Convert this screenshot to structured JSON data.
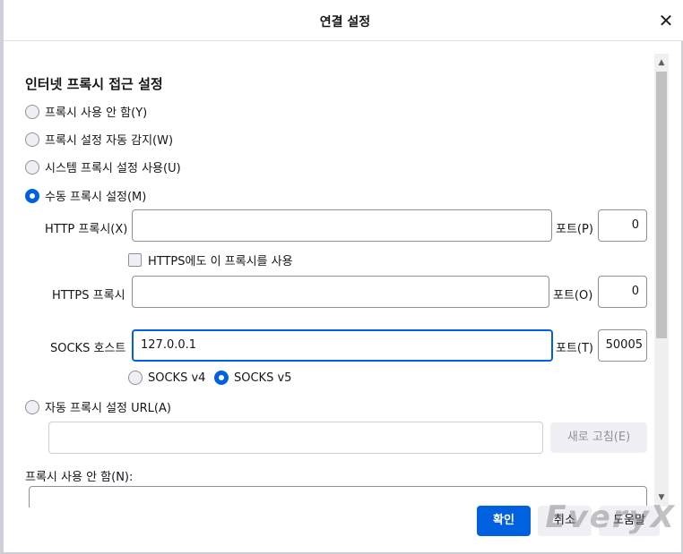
{
  "dialog": {
    "title": "연결 설정",
    "close_icon": "close-icon"
  },
  "proxy": {
    "section_title": "인터넷 프록시 접근 설정",
    "options": [
      {
        "label": "프록시 사용 안 함(Y)",
        "selected": false
      },
      {
        "label": "프록시 설정 자동 감지(W)",
        "selected": false
      },
      {
        "label": "시스템 프록시 설정 사용(U)",
        "selected": false
      },
      {
        "label": "수동 프록시 설정(M)",
        "selected": true
      }
    ],
    "http": {
      "label": "HTTP 프록시(X)",
      "value": "",
      "port_label": "포트(P)",
      "port": "0"
    },
    "https_checkbox": {
      "label": "HTTPS에도 이 프록시를 사용",
      "checked": false
    },
    "https": {
      "label": "HTTPS 프록시",
      "value": "",
      "port_label": "포트(O)",
      "port": "0"
    },
    "socks": {
      "label": "SOCKS 호스트",
      "value": "127.0.0.1",
      "port_label": "포트(T)",
      "port": "50005"
    },
    "socks_versions": [
      {
        "label": "SOCKS v4",
        "selected": false
      },
      {
        "label": "SOCKS v5",
        "selected": true
      }
    ],
    "auto_url": {
      "label": "자동 프록시 설정 URL(A)",
      "value": "",
      "reload_label": "새로 고침(E)"
    },
    "no_proxy_label": "프록시 사용 안 함(N):"
  },
  "footer": {
    "ok_label": "확인",
    "cancel_label": "취소",
    "help_label": "도움말"
  },
  "watermark": "EveryX",
  "colors": {
    "accent": "#0061e0",
    "disabled_bg": "#f0f0f4"
  }
}
